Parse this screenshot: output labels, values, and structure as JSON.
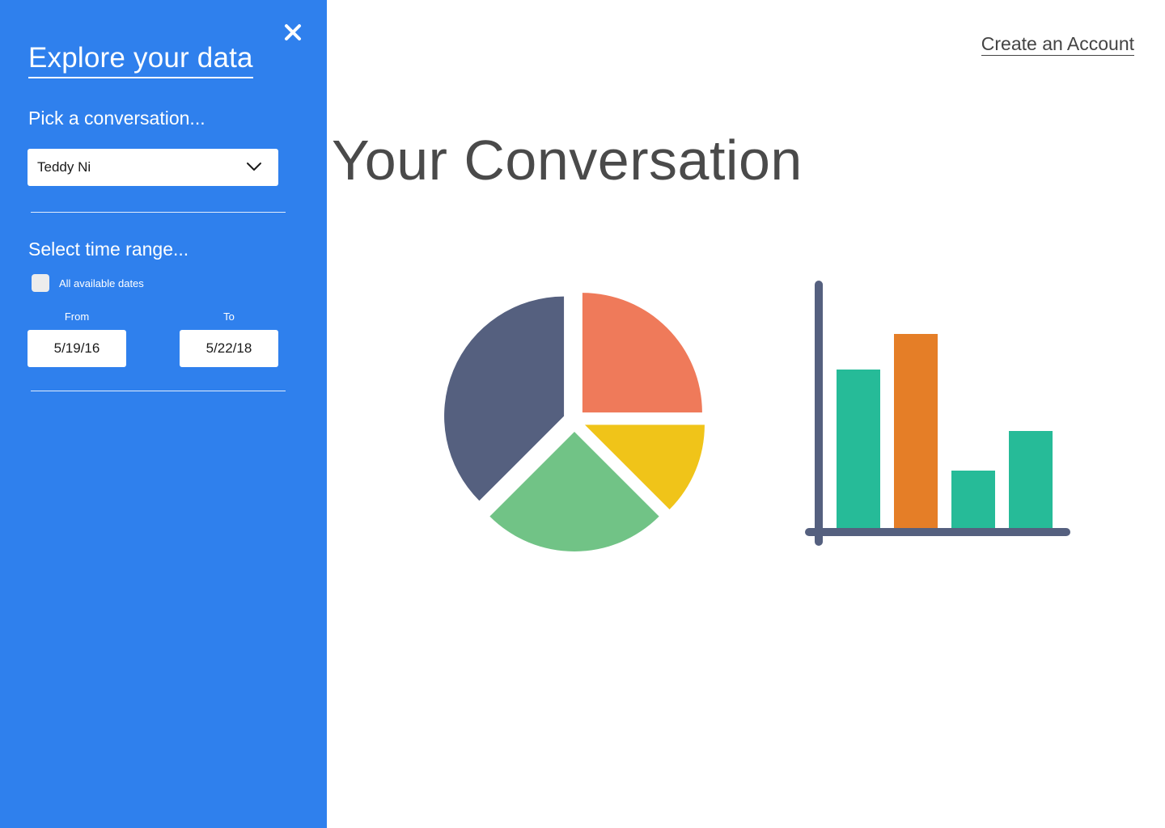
{
  "sidebar": {
    "title": "Explore your data",
    "conversation_label": "Pick a conversation...",
    "conversation_selected": "Teddy Ni",
    "time_range_label": "Select time range...",
    "all_dates_label": "All available dates",
    "from_label": "From",
    "to_label": "To",
    "from_value": "5/19/16",
    "to_value": "5/22/18"
  },
  "header": {
    "create_account": "Create an Account"
  },
  "main": {
    "title": "Your Conversation"
  },
  "colors": {
    "sidebar_bg": "#2f80ed",
    "pie_navy": "#55607f",
    "pie_coral": "#ef7a5a",
    "pie_yellow": "#f0c419",
    "pie_green": "#71c386",
    "bar_teal": "#26bb98",
    "bar_orange": "#e57e27",
    "axis": "#55607f"
  },
  "icons": {
    "close": "close-icon",
    "dropdown": "chevron-down-icon",
    "pie": "pie-chart-illustration",
    "bar": "bar-chart-illustration"
  }
}
